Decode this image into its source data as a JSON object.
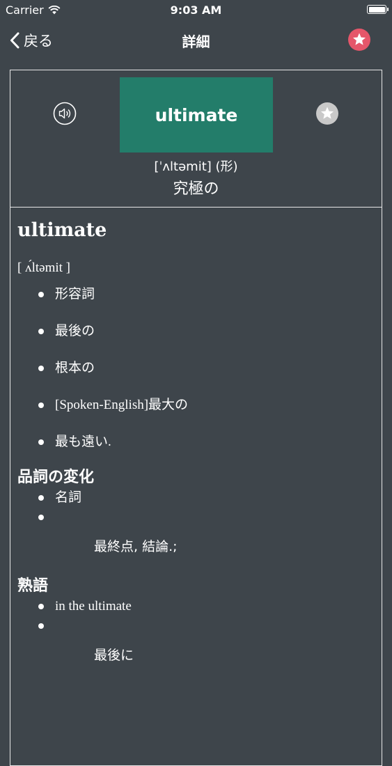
{
  "status_bar": {
    "carrier": "Carrier",
    "time": "9:03 AM"
  },
  "nav": {
    "back_label": "戻る",
    "title": "詳細",
    "fav_color": "#e5566a"
  },
  "card": {
    "word": "ultimate",
    "word_box_color": "#237d6a",
    "pronunciation": "[ˈʌltəmit] (形)",
    "meaning": "究極の"
  },
  "entry": {
    "word": "ultimate",
    "pronunciation": "[ ʌ́ltəmit ]",
    "definitions": [
      "形容詞",
      "最後の",
      "根本の",
      "[Spoken-English]最大の",
      "最も遠い."
    ],
    "inflection_heading": "品詞の変化",
    "inflections": [
      "名詞",
      ""
    ],
    "inflection_detail": "最終点, 結論.;",
    "idiom_heading": "熟語",
    "idioms": [
      "in the ultimate",
      ""
    ],
    "idiom_detail": "最後に"
  }
}
